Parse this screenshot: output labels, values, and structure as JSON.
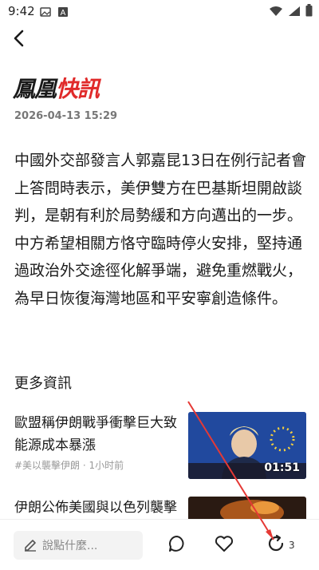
{
  "status_bar": {
    "time": "9:42"
  },
  "header": {
    "brand_part1": "鳳凰",
    "brand_part2": "快訊"
  },
  "article": {
    "date": "2026-04-13 15:29",
    "body": "中國外交部發言人郭嘉昆13日在例行記者會上答問時表示，美伊雙方在巴基斯坦開啟談判，是朝有利於局勢緩和方向邁出的一步。中方希望相關方恪守臨時停火安排，堅持通過政治外交途徑化解爭端，避免重燃戰火，為早日恢復海灣地區和平安寧創造條件。"
  },
  "more_news": {
    "title": "更多資訊",
    "items": [
      {
        "title": "歐盟稱伊朗戰爭衝擊巨大致能源成本暴漲",
        "meta": "#美以襲擊伊朗 · 1小时前",
        "duration": "01:51"
      },
      {
        "title": "伊朗公佈美國與以色列襲擊",
        "meta": "",
        "duration": ""
      }
    ]
  },
  "bottom_bar": {
    "comment_placeholder": "說點什麼...",
    "share_count": "3"
  },
  "colors": {
    "brand_red": "#e02a2a",
    "text": "#1a1a1a",
    "muted": "#999999",
    "annotation_red": "#e53935"
  },
  "icons": [
    "back-arrow-icon",
    "comment-icon",
    "heart-icon",
    "share-icon",
    "pencil-icon"
  ]
}
